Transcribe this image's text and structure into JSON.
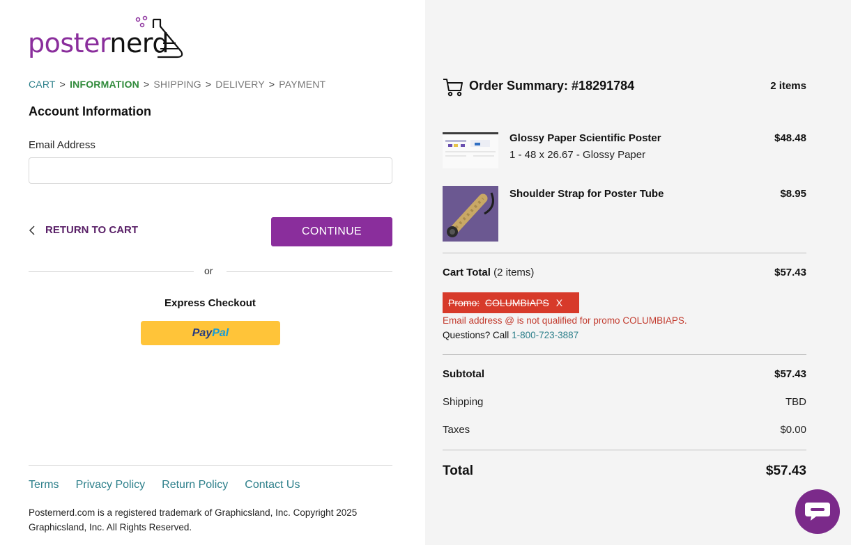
{
  "brand": {
    "part1": "poster",
    "part2": "nerd",
    "color": "#8a2e9c"
  },
  "breadcrumb": [
    {
      "label": "CART",
      "state": "link"
    },
    {
      "label": "INFORMATION",
      "state": "active"
    },
    {
      "label": "SHIPPING",
      "state": "muted"
    },
    {
      "label": "DELIVERY",
      "state": "muted"
    },
    {
      "label": "PAYMENT",
      "state": "muted"
    }
  ],
  "breadcrumb_sep": ">",
  "account": {
    "title": "Account Information",
    "email_label": "Email Address",
    "email_value": "",
    "email_placeholder": ""
  },
  "actions": {
    "return_label": "RETURN TO CART",
    "continue_label": "CONTINUE",
    "or_label": "or",
    "express_title": "Express Checkout",
    "paypal_part1": "Pay",
    "paypal_part2": "Pal"
  },
  "footer": {
    "links": [
      "Terms",
      "Privacy Policy",
      "Return Policy",
      "Contact Us"
    ],
    "copyright": "Posternerd.com is a registered trademark of Graphicsland, Inc. Copyright 2025 Graphicsland, Inc. All Rights Reserved."
  },
  "summary": {
    "title": "Order Summary: #18291784",
    "items_count": "2 items",
    "items": [
      {
        "name": "Glossy Paper Scientific Poster",
        "desc": "1 - 48 x 26.67 - Glossy Paper",
        "price": "$48.48"
      },
      {
        "name": "Shoulder Strap for Poster Tube",
        "desc": "",
        "price": "$8.95"
      }
    ],
    "cart_total_label": "Cart Total",
    "cart_total_count": "(2 items)",
    "cart_total_value": "$57.43",
    "promo_label": "Promo:",
    "promo_code": "COLUMBIAPS",
    "promo_remove": "X",
    "promo_error": "Email address @ is not qualified for promo COLUMBIAPS.",
    "questions_label": "Questions? Call",
    "phone": "1-800-723-3887",
    "subtotal_label": "Subtotal",
    "subtotal_value": "$57.43",
    "shipping_label": "Shipping",
    "shipping_value": "TBD",
    "taxes_label": "Taxes",
    "taxes_value": "$0.00",
    "total_label": "Total",
    "total_value": "$57.43"
  },
  "colors": {
    "accent": "#8a2e9c",
    "link": "#2c7f8a",
    "active_step": "#2f8a3a",
    "promo_bg": "#d73a2a",
    "error": "#c23b2e",
    "paypal_yellow": "#ffc439"
  },
  "icons": {
    "cart": "shopping-cart-icon",
    "back": "chevron-left-icon",
    "chat": "chat-bubble-icon",
    "logo": "flask-icon"
  }
}
